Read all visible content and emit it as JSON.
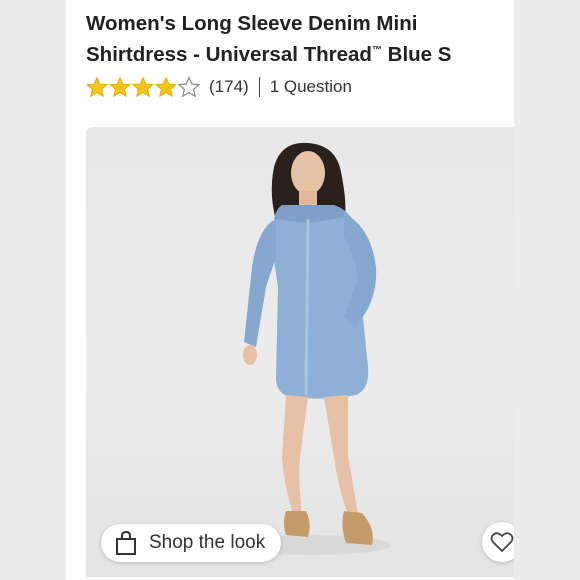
{
  "product": {
    "title_main": "Women's Long Sleeve Denim Mini Shirtdress - Universal Thread",
    "trademark": "™",
    "title_tail": " Blue S",
    "rating": 4,
    "rating_max": 5,
    "review_count": "(174)",
    "questions": "1 Question"
  },
  "actions": {
    "shop_the_look": "Shop the look"
  },
  "icons": {
    "bag": "shopping-bag-icon",
    "heart": "heart-icon",
    "star": "star-icon"
  },
  "colors": {
    "star_fill": "#f5c518",
    "star_outline": "#888888",
    "denim": "#8fb0d6"
  }
}
